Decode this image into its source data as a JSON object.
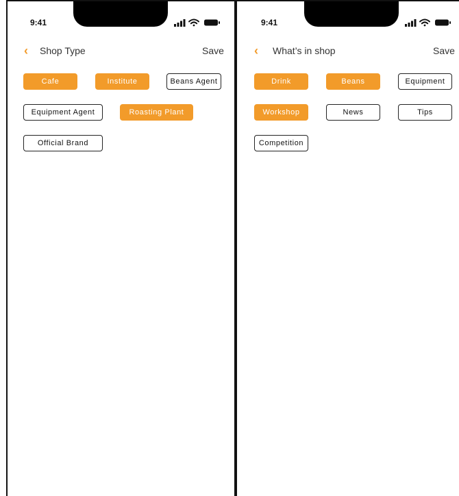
{
  "colors": {
    "accent": "#f29b2a",
    "text": "#333333",
    "border": "#222222"
  },
  "screens": [
    {
      "status": {
        "time": "9:41",
        "icons": [
          "signal-icon",
          "wifi-icon",
          "battery-icon"
        ]
      },
      "nav": {
        "back_icon": "‹",
        "title": "Shop Type",
        "save_label": "Save"
      },
      "chips": [
        {
          "label": "Cafe",
          "selected": true
        },
        {
          "label": "Institute",
          "selected": true
        },
        {
          "label": "Beans Agent",
          "selected": false
        },
        {
          "label": "Equipment Agent",
          "selected": false
        },
        {
          "label": "Roasting Plant",
          "selected": true
        },
        {
          "label": "Official Brand",
          "selected": false
        }
      ]
    },
    {
      "status": {
        "time": "9:41",
        "icons": [
          "signal-icon",
          "wifi-icon",
          "battery-icon"
        ]
      },
      "nav": {
        "back_icon": "‹",
        "title": "What’s in shop",
        "save_label": "Save"
      },
      "chips": [
        {
          "label": "Drink",
          "selected": true
        },
        {
          "label": "Beans",
          "selected": true
        },
        {
          "label": "Equipment",
          "selected": false
        },
        {
          "label": "Workshop",
          "selected": true
        },
        {
          "label": "News",
          "selected": false
        },
        {
          "label": "Tips",
          "selected": false
        },
        {
          "label": "Competition",
          "selected": false
        }
      ]
    }
  ]
}
